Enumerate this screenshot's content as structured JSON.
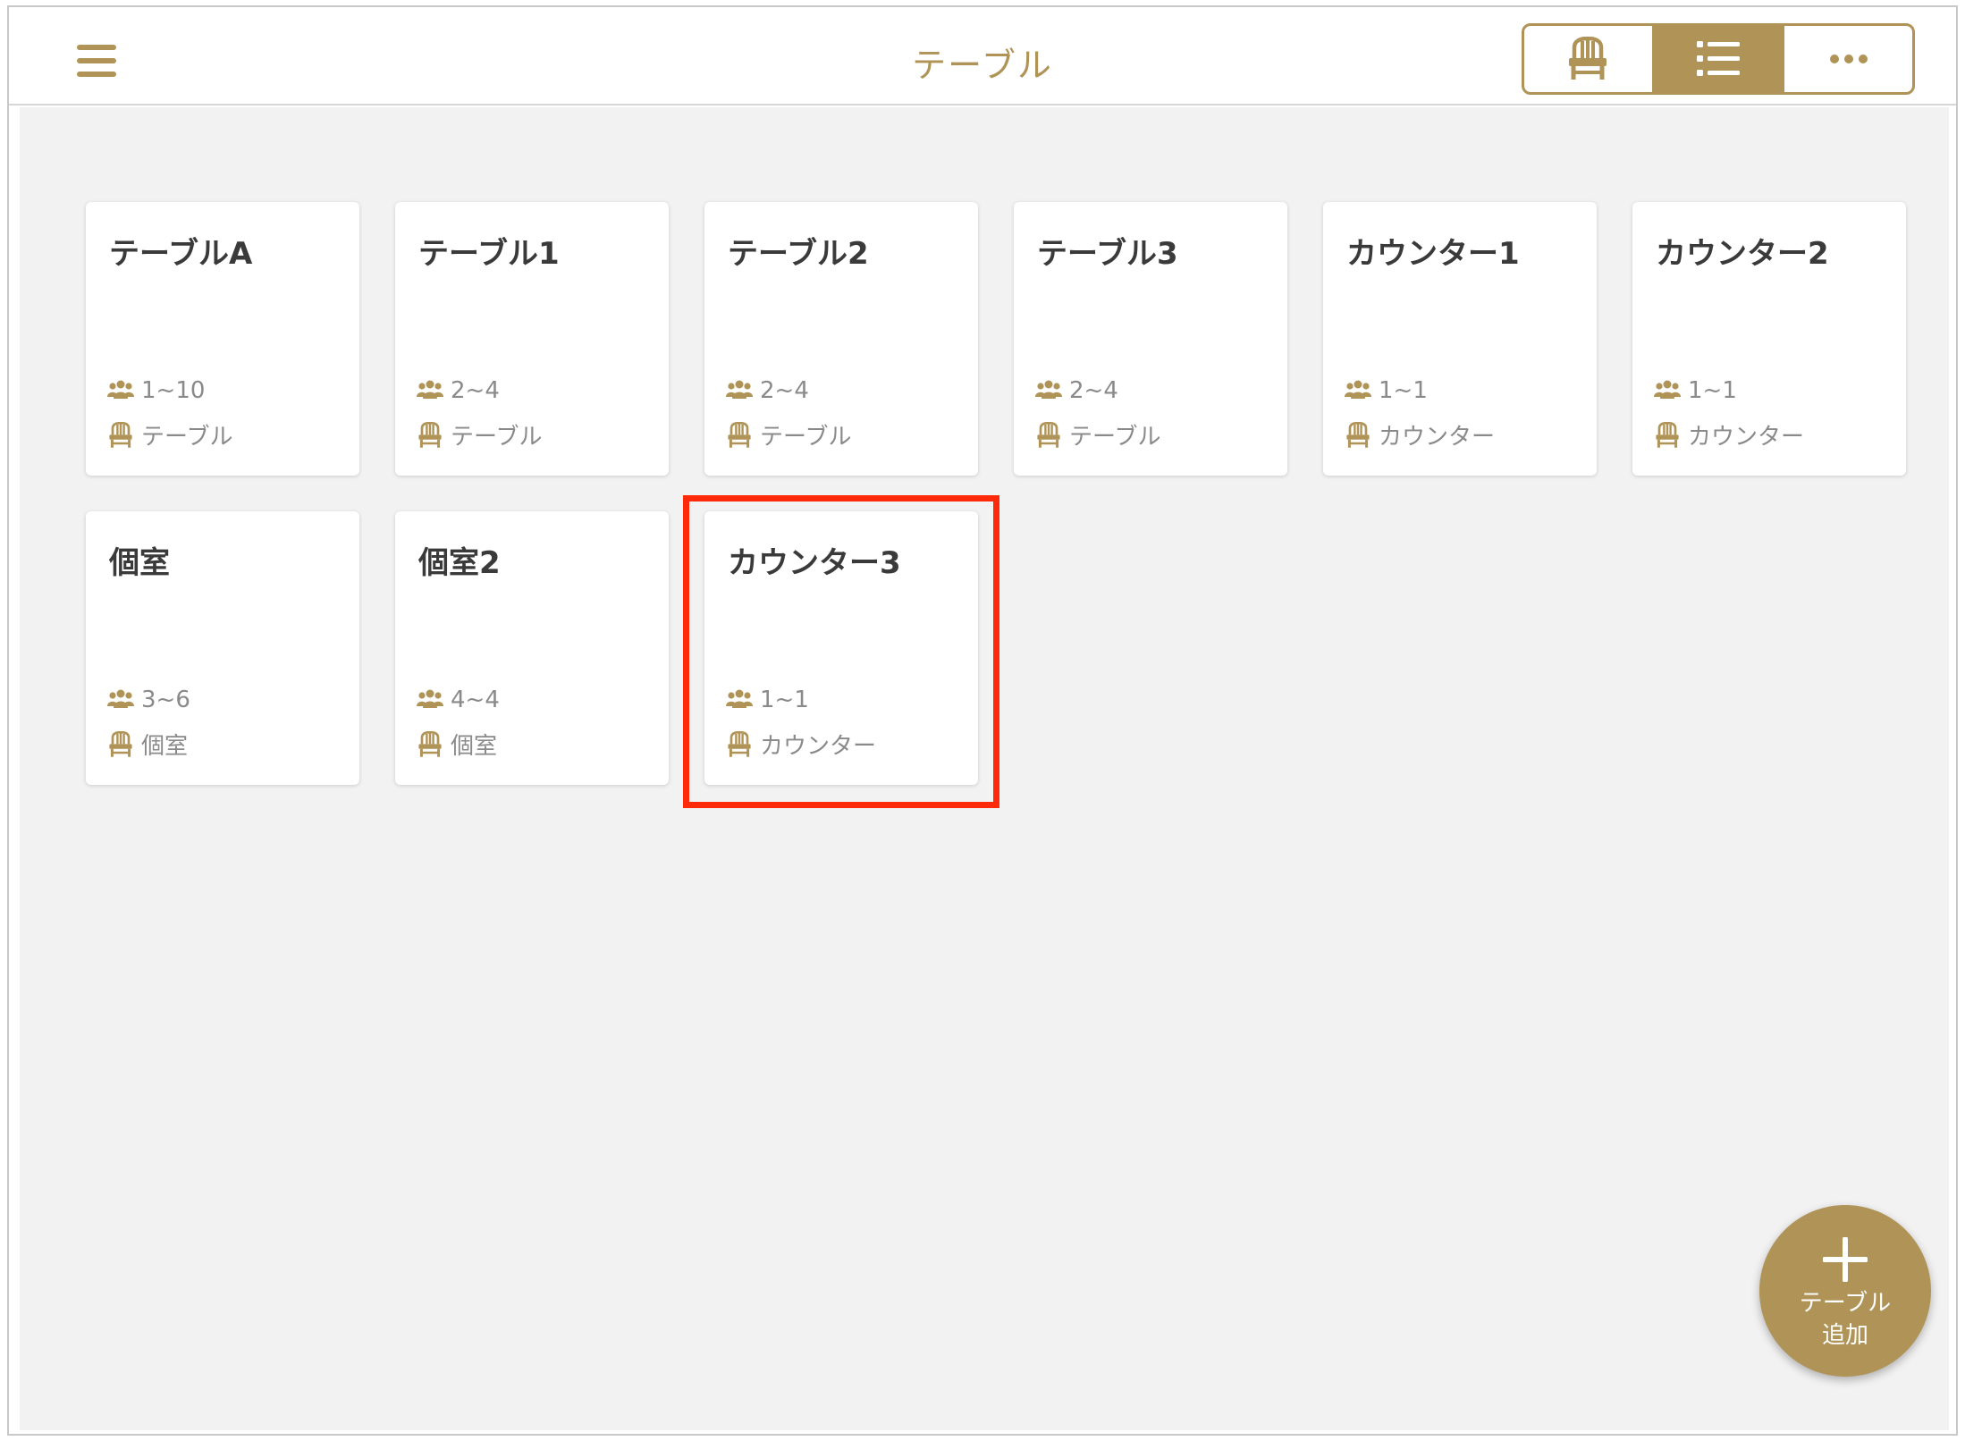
{
  "header": {
    "title": "テーブル",
    "view_switch": [
      {
        "icon": "chair-icon",
        "active": false
      },
      {
        "icon": "list-icon",
        "active": true
      },
      {
        "icon": "more-icon",
        "active": false
      }
    ]
  },
  "tables": [
    {
      "name": "テーブルA",
      "capacity": "1~10",
      "type": "テーブル"
    },
    {
      "name": "テーブル1",
      "capacity": "2~4",
      "type": "テーブル"
    },
    {
      "name": "テーブル2",
      "capacity": "2~4",
      "type": "テーブル"
    },
    {
      "name": "テーブル3",
      "capacity": "2~4",
      "type": "テーブル"
    },
    {
      "name": "カウンター1",
      "capacity": "1~1",
      "type": "カウンター"
    },
    {
      "name": "カウンター2",
      "capacity": "1~1",
      "type": "カウンター"
    },
    {
      "name": "個室",
      "capacity": "3~6",
      "type": "個室"
    },
    {
      "name": "個室2",
      "capacity": "4~4",
      "type": "個室"
    },
    {
      "name": "カウンター3",
      "capacity": "1~1",
      "type": "カウンター"
    }
  ],
  "fab": {
    "line1": "テーブル",
    "line2": "追加"
  },
  "colors": {
    "accent": "#b09457",
    "highlight": "#ff2a0a",
    "background": "#f2f2f2"
  }
}
